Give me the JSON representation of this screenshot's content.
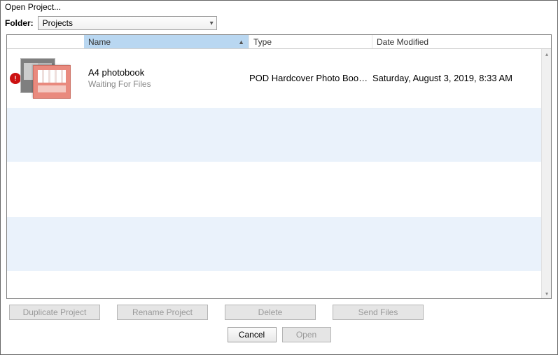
{
  "window": {
    "title": "Open Project..."
  },
  "folder": {
    "label": "Folder:",
    "selected": "Projects"
  },
  "columns": {
    "name": "Name",
    "type": "Type",
    "date": "Date Modified"
  },
  "rows": [
    {
      "name": "A4 photobook",
      "status": "Waiting For Files",
      "type": "POD Hardcover Photo Book, A...",
      "modified": "Saturday, August 3, 2019, 8:33 AM",
      "badge": "!"
    }
  ],
  "actions": {
    "duplicate": "Duplicate Project",
    "rename": "Rename Project",
    "delete": "Delete",
    "send": "Send Files"
  },
  "footer": {
    "cancel": "Cancel",
    "open": "Open"
  }
}
